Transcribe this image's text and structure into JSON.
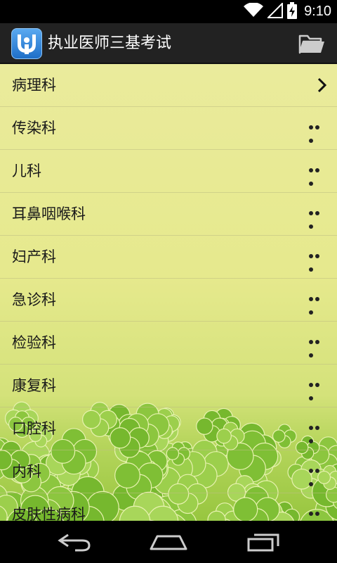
{
  "status_bar": {
    "time": "9:10"
  },
  "action_bar": {
    "title": "执业医师三基考试"
  },
  "list": [
    {
      "label": "病理科",
      "accessory": "chevron"
    },
    {
      "label": "传染科",
      "accessory": "more"
    },
    {
      "label": "儿科",
      "accessory": "more"
    },
    {
      "label": "耳鼻咽喉科",
      "accessory": "more"
    },
    {
      "label": "妇产科",
      "accessory": "more"
    },
    {
      "label": "急诊科",
      "accessory": "more"
    },
    {
      "label": "检验科",
      "accessory": "more"
    },
    {
      "label": "康复科",
      "accessory": "more"
    },
    {
      "label": "口腔科",
      "accessory": "more"
    },
    {
      "label": "内科",
      "accessory": "more"
    },
    {
      "label": "皮肤性病科",
      "accessory": "more"
    }
  ],
  "icons": {
    "wifi": "wifi-icon",
    "signal": "signal-icon",
    "battery": "battery-charging-icon",
    "app": "app-icon",
    "folder": "folder-icon",
    "back": "back-icon",
    "home": "home-icon",
    "recents": "recents-icon"
  },
  "colors": {
    "action_bar": "#222222",
    "list_background_top": "#eaeb9c",
    "clover_green": "#8cc63f",
    "text": "#1a1a1a"
  }
}
